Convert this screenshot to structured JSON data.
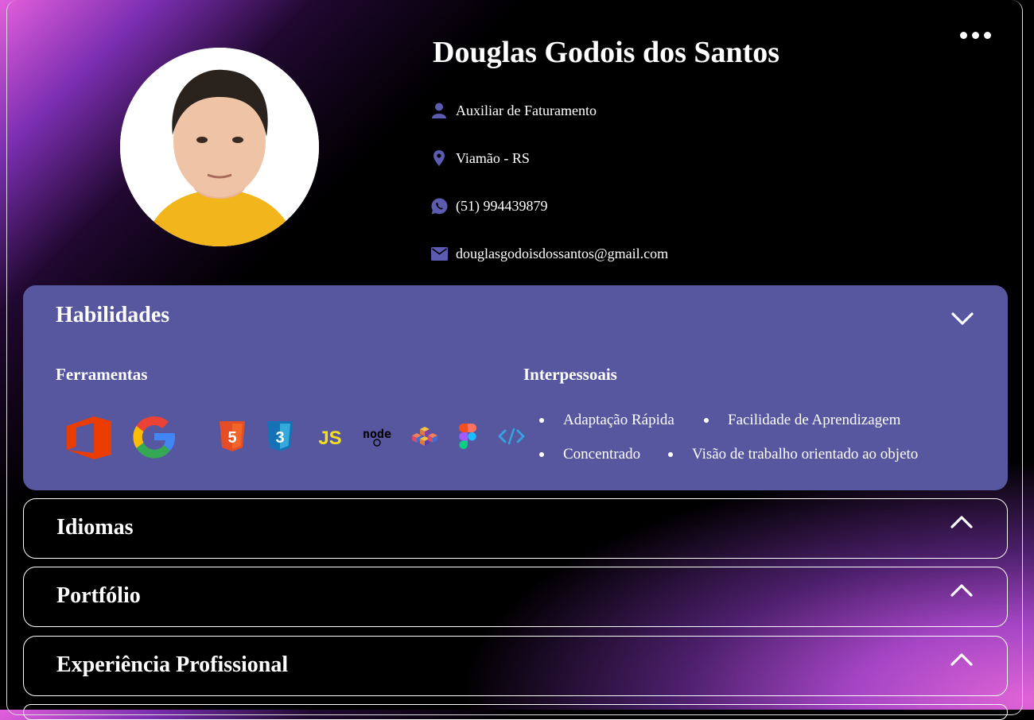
{
  "profile": {
    "name": "Douglas Godois dos Santos",
    "role": "Auxiliar de Faturamento",
    "location": "Viamão - RS",
    "phone": "(51) 994439879",
    "email": "douglasgodoisdossantos@gmail.com",
    "icons": [
      "user-icon",
      "map-pin-icon",
      "whatsapp-icon",
      "email-icon"
    ]
  },
  "habilidades": {
    "title": "Habilidades",
    "tools_heading": "Ferramentas",
    "soft_heading": "Interpessoais",
    "tools": [
      {
        "icon": "office-icon",
        "label": "Microsoft Office"
      },
      {
        "icon": "google-icon",
        "label": "Google"
      },
      {
        "icon": "html5-icon",
        "label": "HTML5"
      },
      {
        "icon": "css3-icon",
        "label": "CSS3"
      },
      {
        "icon": "javascript-icon",
        "label": "JS"
      },
      {
        "icon": "nodejs-icon",
        "label": "node"
      },
      {
        "icon": "blocks-icon",
        "label": "Blocks"
      },
      {
        "icon": "figma-icon",
        "label": "Figma"
      },
      {
        "icon": "code-icon",
        "label": "</>"
      }
    ],
    "soft_skills": [
      "Adaptação Rápida",
      "Facilidade de Aprendizagem",
      "Concentrado",
      "Visão de trabalho orientado ao objeto"
    ]
  },
  "sections": [
    {
      "title": "Idiomas"
    },
    {
      "title": "Portfólio"
    },
    {
      "title": "Experiência Profissional"
    }
  ],
  "colors": {
    "panel": "#5757a0",
    "icon_accent": "#5b5bb0",
    "gradient_pink": "#e35fdc"
  }
}
